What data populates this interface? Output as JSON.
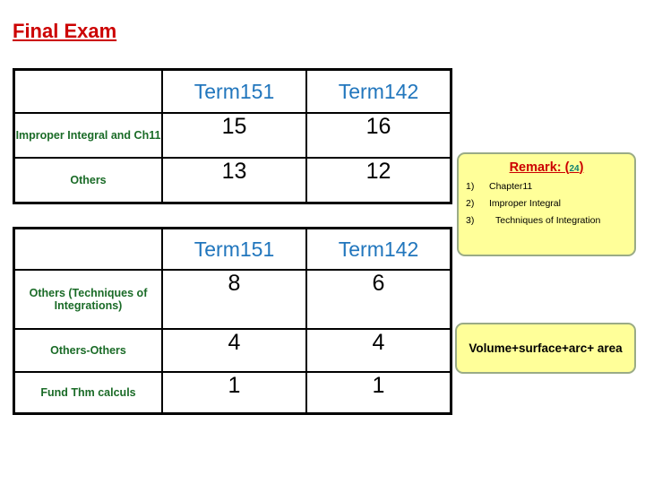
{
  "slide": {
    "title": "Final Exam"
  },
  "table_one": {
    "headers": [
      "",
      "Term151",
      "Term142"
    ],
    "rows": [
      {
        "label": "Improper Integral and Ch11",
        "term151": "15",
        "term142": "16"
      },
      {
        "label": "Others",
        "term151": "13",
        "term142": "12"
      }
    ]
  },
  "table_two": {
    "headers": [
      "",
      "Term151",
      "Term142"
    ],
    "rows": [
      {
        "label": "Others (Techniques of Integrations)",
        "term151": "8",
        "term142": "6"
      },
      {
        "label": "Others-Others",
        "term151": "4",
        "term142": "4"
      },
      {
        "label": "Fund Thm calculs",
        "term151": "1",
        "term142": "1"
      }
    ]
  },
  "remark_box": {
    "heading_prefix": "Remark: (",
    "heading_count": "24",
    "heading_suffix": ")",
    "items": [
      {
        "marker": "1)",
        "text": "Chapter11"
      },
      {
        "marker": "2)",
        "text": "Improper Integral"
      },
      {
        "marker": "3)",
        "text": "Techniques of Integration"
      }
    ]
  },
  "volume_box": {
    "text": "Volume+surface+arc+ area"
  },
  "colors": {
    "title_red": "#cc0000",
    "header_blue": "#2176bd",
    "label_green": "#1a6b27",
    "callout_fill": "#ffff99",
    "callout_border": "#9aab86",
    "count_teal": "#108272"
  }
}
